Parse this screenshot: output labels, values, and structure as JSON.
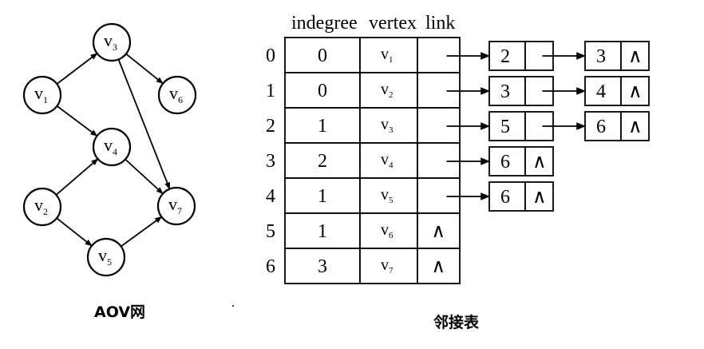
{
  "graph": {
    "caption": "AOV网",
    "nodes": [
      {
        "id": "v1",
        "label": "v",
        "sub": "1"
      },
      {
        "id": "v2",
        "label": "v",
        "sub": "2"
      },
      {
        "id": "v3",
        "label": "v",
        "sub": "3"
      },
      {
        "id": "v4",
        "label": "v",
        "sub": "4"
      },
      {
        "id": "v5",
        "label": "v",
        "sub": "5"
      },
      {
        "id": "v6",
        "label": "v",
        "sub": "6"
      },
      {
        "id": "v7",
        "label": "v",
        "sub": "7"
      }
    ],
    "edges": [
      [
        "v1",
        "v3"
      ],
      [
        "v1",
        "v4"
      ],
      [
        "v3",
        "v6"
      ],
      [
        "v3",
        "v7"
      ],
      [
        "v2",
        "v4"
      ],
      [
        "v2",
        "v5"
      ],
      [
        "v4",
        "v7"
      ],
      [
        "v5",
        "v7"
      ]
    ]
  },
  "table": {
    "caption": "邻接表",
    "headers": [
      "indegree",
      "vertex",
      "link"
    ],
    "null_symbol": "∧",
    "rows": [
      {
        "index": "0",
        "indegree": "0",
        "vertex": "v",
        "sub": "1",
        "list": [
          "2",
          "3"
        ]
      },
      {
        "index": "1",
        "indegree": "0",
        "vertex": "v",
        "sub": "2",
        "list": [
          "3",
          "4"
        ]
      },
      {
        "index": "2",
        "indegree": "1",
        "vertex": "v",
        "sub": "3",
        "list": [
          "5",
          "6"
        ]
      },
      {
        "index": "3",
        "indegree": "2",
        "vertex": "v",
        "sub": "4",
        "list": [
          "6"
        ]
      },
      {
        "index": "4",
        "indegree": "1",
        "vertex": "v",
        "sub": "5",
        "list": [
          "6"
        ]
      },
      {
        "index": "5",
        "indegree": "1",
        "vertex": "v",
        "sub": "6",
        "list": []
      },
      {
        "index": "6",
        "indegree": "3",
        "vertex": "v",
        "sub": "7",
        "list": []
      }
    ]
  }
}
